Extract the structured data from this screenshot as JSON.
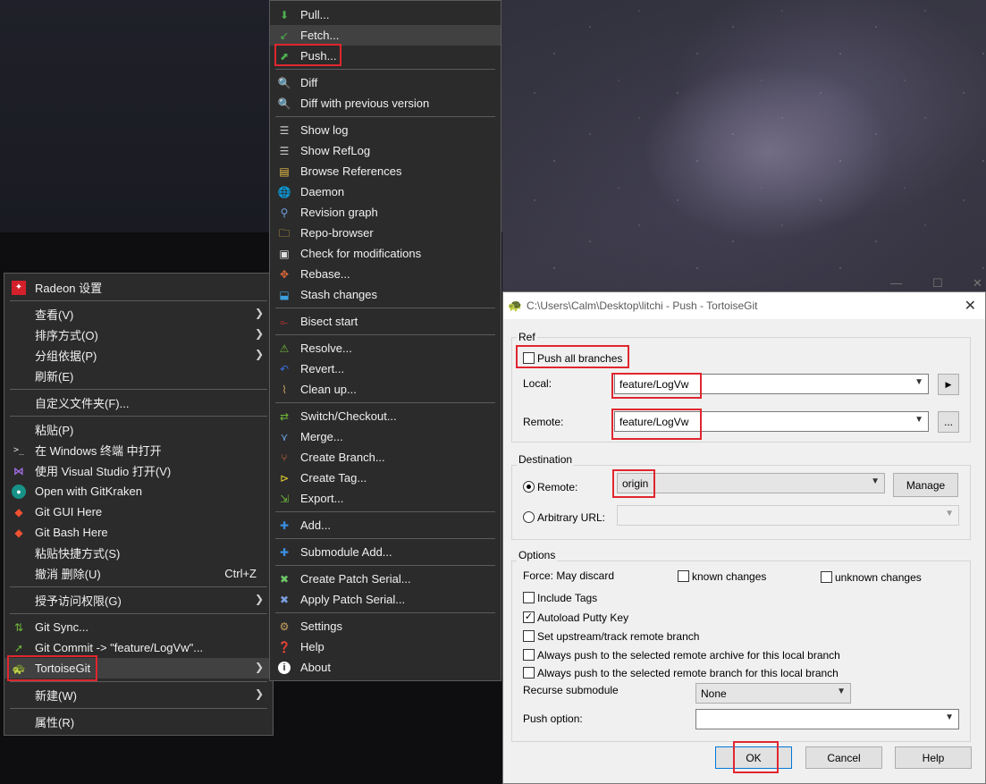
{
  "desktop_menu": {
    "items": [
      {
        "label": "Radeon 设置",
        "icon": "radeon-icon"
      },
      {
        "label": "查看(V)",
        "submenu": true
      },
      {
        "label": "排序方式(O)",
        "submenu": true
      },
      {
        "label": "分组依据(P)",
        "submenu": true
      },
      {
        "label": "刷新(E)"
      },
      {
        "label": "自定义文件夹(F)..."
      },
      {
        "label": "粘贴(P)"
      },
      {
        "label": "在 Windows 终端 中打开",
        "icon": "terminal-icon"
      },
      {
        "label": "使用 Visual Studio 打开(V)",
        "icon": "visual-studio-icon"
      },
      {
        "label": "Open with GitKraken",
        "icon": "gitkraken-icon"
      },
      {
        "label": "Git GUI Here",
        "icon": "git-icon"
      },
      {
        "label": "Git Bash Here",
        "icon": "git-icon"
      },
      {
        "label": "粘贴快捷方式(S)"
      },
      {
        "label": "撤消 删除(U)",
        "shortcut": "Ctrl+Z"
      },
      {
        "label": "授予访问权限(G)",
        "submenu": true
      },
      {
        "label": "Git Sync...",
        "icon": "git-sync-icon"
      },
      {
        "label": "Git Commit -> \"feature/LogVw\"...",
        "icon": "git-commit-icon"
      },
      {
        "label": "TortoiseGit",
        "icon": "tortoisegit-icon",
        "submenu": true
      },
      {
        "label": "新建(W)",
        "submenu": true
      },
      {
        "label": "属性(R)"
      }
    ]
  },
  "tortoise_menu": {
    "items": [
      {
        "label": "Pull...",
        "icon": "pull-icon"
      },
      {
        "label": "Fetch...",
        "icon": "fetch-icon"
      },
      {
        "label": "Push...",
        "icon": "push-icon"
      },
      {
        "label": "Diff",
        "icon": "diff-icon"
      },
      {
        "label": "Diff with previous version",
        "icon": "diff-icon"
      },
      {
        "label": "Show log",
        "icon": "log-icon"
      },
      {
        "label": "Show RefLog",
        "icon": "reflog-icon"
      },
      {
        "label": "Browse References",
        "icon": "references-icon"
      },
      {
        "label": "Daemon",
        "icon": "daemon-icon"
      },
      {
        "label": "Revision graph",
        "icon": "revision-graph-icon"
      },
      {
        "label": "Repo-browser",
        "icon": "repo-browser-icon"
      },
      {
        "label": "Check for modifications",
        "icon": "check-modifications-icon"
      },
      {
        "label": "Rebase...",
        "icon": "rebase-icon"
      },
      {
        "label": "Stash changes",
        "icon": "stash-icon"
      },
      {
        "label": "Bisect start",
        "icon": "bisect-icon"
      },
      {
        "label": "Resolve...",
        "icon": "resolve-icon"
      },
      {
        "label": "Revert...",
        "icon": "revert-icon"
      },
      {
        "label": "Clean up...",
        "icon": "cleanup-icon"
      },
      {
        "label": "Switch/Checkout...",
        "icon": "switch-icon"
      },
      {
        "label": "Merge...",
        "icon": "merge-icon"
      },
      {
        "label": "Create Branch...",
        "icon": "branch-icon"
      },
      {
        "label": "Create Tag...",
        "icon": "tag-icon"
      },
      {
        "label": "Export...",
        "icon": "export-icon"
      },
      {
        "label": "Add...",
        "icon": "add-icon"
      },
      {
        "label": "Submodule Add...",
        "icon": "submodule-add-icon"
      },
      {
        "label": "Create Patch Serial...",
        "icon": "create-patch-icon"
      },
      {
        "label": "Apply Patch Serial...",
        "icon": "apply-patch-icon"
      },
      {
        "label": "Settings",
        "icon": "settings-icon"
      },
      {
        "label": "Help",
        "icon": "help-icon"
      },
      {
        "label": "About",
        "icon": "about-icon"
      }
    ]
  },
  "dialog": {
    "title": "C:\\Users\\Calm\\Desktop\\litchi - Push - TortoiseGit",
    "ref_group": "Ref",
    "push_all_branches": "Push all branches",
    "local_label": "Local:",
    "local_value": "feature/LogVw",
    "remote_label": "Remote:",
    "remote_value": "feature/LogVw",
    "remote_more": "...",
    "destination_group": "Destination",
    "dest_remote_label": "Remote:",
    "dest_remote_value": "origin",
    "manage_button": "Manage",
    "arbitrary_url_label": "Arbitrary URL:",
    "options_group": "Options",
    "force_label": "Force: May discard",
    "known_changes": "known changes",
    "unknown_changes": "unknown changes",
    "include_tags": "Include Tags",
    "autoload_putty": "Autoload Putty Key",
    "set_upstream": "Set upstream/track remote branch",
    "always_push_archive": "Always push to the selected remote archive for this local branch",
    "always_push_branch": "Always push to the selected remote branch for this local branch",
    "recurse_submodule_label": "Recurse submodule",
    "recurse_submodule_value": "None",
    "push_option_label": "Push option:",
    "ok_button": "OK",
    "cancel_button": "Cancel",
    "help_button": "Help",
    "checked": {
      "autoload_putty": true,
      "push_all_branches": false,
      "include_tags": false
    }
  },
  "colors": {
    "highlight_box": "#e0262f",
    "menu_bg": "#2b2b2b"
  }
}
